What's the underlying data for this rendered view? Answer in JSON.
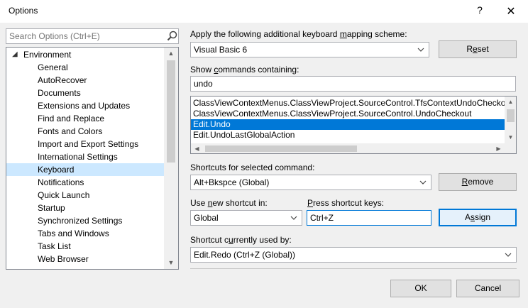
{
  "window": {
    "title": "Options",
    "help_glyph": "?",
    "close_glyph": "✕"
  },
  "search": {
    "placeholder": "Search Options (Ctrl+E)",
    "value": ""
  },
  "tree": {
    "root_label": "Environment",
    "root_expanded": true,
    "items": [
      {
        "label": "General",
        "selected": false
      },
      {
        "label": "AutoRecover",
        "selected": false
      },
      {
        "label": "Documents",
        "selected": false
      },
      {
        "label": "Extensions and Updates",
        "selected": false
      },
      {
        "label": "Find and Replace",
        "selected": false
      },
      {
        "label": "Fonts and Colors",
        "selected": false
      },
      {
        "label": "Import and Export Settings",
        "selected": false
      },
      {
        "label": "International Settings",
        "selected": false
      },
      {
        "label": "Keyboard",
        "selected": true
      },
      {
        "label": "Notifications",
        "selected": false
      },
      {
        "label": "Quick Launch",
        "selected": false
      },
      {
        "label": "Startup",
        "selected": false
      },
      {
        "label": "Synchronized Settings",
        "selected": false
      },
      {
        "label": "Tabs and Windows",
        "selected": false
      },
      {
        "label": "Task List",
        "selected": false
      },
      {
        "label": "Web Browser",
        "selected": false
      }
    ]
  },
  "mapping": {
    "label_pre": "Apply the following additional keyboard ",
    "label_key": "m",
    "label_post": "apping scheme:",
    "value": "Visual Basic 6",
    "reset_pre": "R",
    "reset_key": "e",
    "reset_post": "set"
  },
  "commands": {
    "label_pre": "Show ",
    "label_key": "c",
    "label_post": "ommands containing:",
    "filter_value": "undo",
    "items": [
      {
        "label": "ClassViewContextMenus.ClassViewProject.SourceControl.TfsContextUndoCheckout",
        "selected": false
      },
      {
        "label": "ClassViewContextMenus.ClassViewProject.SourceControl.UndoCheckout",
        "selected": false
      },
      {
        "label": "Edit.Undo",
        "selected": true
      },
      {
        "label": "Edit.UndoLastGlobalAction",
        "selected": false
      }
    ]
  },
  "shortcuts": {
    "label": "Shortcuts for selected command:",
    "value": "Alt+Bkspce (Global)",
    "remove_pre": "",
    "remove_key": "R",
    "remove_post": "emove"
  },
  "new_shortcut": {
    "label_pre": "Use ",
    "label_key": "n",
    "label_post": "ew shortcut in:",
    "scope_value": "Global"
  },
  "press_keys": {
    "label_pre": "",
    "label_key": "P",
    "label_post": "ress shortcut keys:",
    "value": "Ctrl+Z",
    "assign_pre": "A",
    "assign_key": "s",
    "assign_post": "sign"
  },
  "used_by": {
    "label_pre": "Shortcut c",
    "label_key": "u",
    "label_post": "rrently used by:",
    "value": "Edit.Redo (Ctrl+Z (Global))"
  },
  "footer": {
    "ok_label": "OK",
    "cancel_label": "Cancel"
  }
}
